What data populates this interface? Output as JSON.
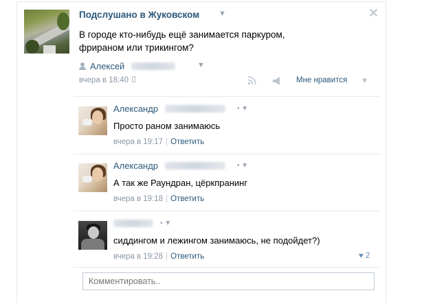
{
  "post": {
    "group_name": "Подслушано в Жуковском",
    "text_line1": "В городе кто-нибудь ещё занимается паркуром,",
    "text_line2": "фрираном или трикингом?",
    "author_first_name": "Алексей",
    "time": "вчера в 18:40",
    "like_label": "Мне нравится"
  },
  "icons": {
    "caret": "▼",
    "close": "✕",
    "heart": "♥"
  },
  "comments": [
    {
      "author": "Александр",
      "text": "Просто раном занимаюсь",
      "time": "вчера в 19:17",
      "reply": "Ответить"
    },
    {
      "author": "Александр",
      "text": "А так же Раундран, цёркпранинг",
      "time": "вчера в 19:18",
      "reply": "Ответить"
    },
    {
      "author": "",
      "text": "сиддингом и лежингом занимаюсь, не подойдет?)",
      "time": "вчера в 19:28",
      "reply": "Ответить",
      "likes": "2"
    }
  ],
  "comment_input": {
    "placeholder": "Комментировать.."
  },
  "colors": {
    "link": "#2b587a",
    "meta": "#8a97a5",
    "divider": "#e7e8ec"
  }
}
